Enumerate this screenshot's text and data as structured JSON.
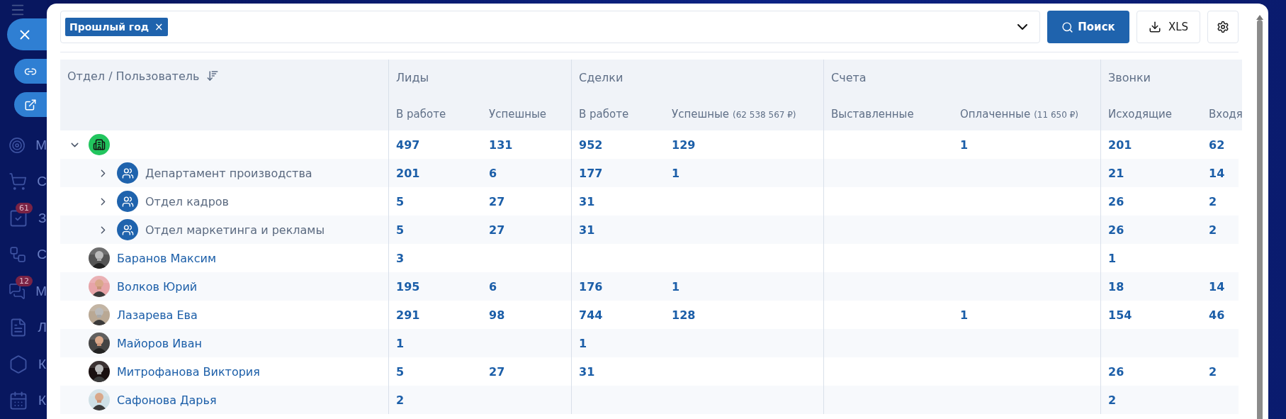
{
  "sidebar": {
    "items": [
      {
        "label": "М"
      },
      {
        "label": "С"
      },
      {
        "label": "З",
        "badge": "61"
      },
      {
        "label": "С"
      },
      {
        "label": "М",
        "badge": "12"
      },
      {
        "label": "Л"
      },
      {
        "label": "К"
      },
      {
        "label": "К"
      }
    ]
  },
  "filter": {
    "tags": [
      {
        "label": "Прошлый год",
        "remove": "×"
      }
    ]
  },
  "buttons": {
    "search": "Поиск",
    "export": "XLS"
  },
  "table": {
    "first_column": "Отдел / Пользователь",
    "groups": [
      {
        "title": "Лиды",
        "columns": [
          {
            "label": "В работе"
          },
          {
            "label": "Успешные"
          }
        ]
      },
      {
        "title": "Сделки",
        "columns": [
          {
            "label": "В работе"
          },
          {
            "label": "Успешные",
            "sum": "(62 538 567 ₽)"
          }
        ]
      },
      {
        "title": "Счета",
        "columns": [
          {
            "label": "Выставленные"
          },
          {
            "label": "Оплаченные",
            "sum": "(11 650 ₽)"
          }
        ]
      },
      {
        "title": "Звонки",
        "columns": [
          {
            "label": "Исходящие"
          },
          {
            "label": "Входя"
          }
        ]
      }
    ],
    "rows": [
      {
        "kind": "company",
        "expanded": true,
        "values": {
          "leads_in_work": "497",
          "leads_successful": "131",
          "deals_in_work": "952",
          "deals_successful": "129",
          "invoices_paid": "1",
          "calls_outgoing": "201",
          "column_9": "62"
        },
        "children": [
          {
            "kind": "department",
            "name": "Департамент производства",
            "expanded": false,
            "values": {
              "leads_in_work": "201",
              "leads_successful": "6",
              "deals_in_work": "177",
              "deals_successful": "1",
              "calls_outgoing": "21",
              "column_9": "14"
            }
          },
          {
            "kind": "department",
            "name": "Отдел кадров",
            "expanded": false,
            "values": {
              "leads_in_work": "5",
              "leads_successful": "27",
              "deals_in_work": "31",
              "calls_outgoing": "26",
              "column_9": "2"
            }
          },
          {
            "kind": "department",
            "name": "Отдел маркетинга и рекламы",
            "expanded": false,
            "values": {
              "leads_in_work": "5",
              "leads_successful": "27",
              "deals_in_work": "31",
              "calls_outgoing": "26",
              "column_9": "2"
            }
          },
          {
            "kind": "user",
            "name": "Баранов Максим",
            "values": {
              "leads_in_work": "3",
              "calls_outgoing": "1"
            }
          },
          {
            "kind": "user",
            "name": "Волков Юрий",
            "values": {
              "leads_in_work": "195",
              "leads_successful": "6",
              "deals_in_work": "176",
              "deals_successful": "1",
              "calls_outgoing": "18",
              "column_9": "14"
            }
          },
          {
            "kind": "user",
            "name": "Лазарева Ева",
            "values": {
              "leads_in_work": "291",
              "leads_successful": "98",
              "deals_in_work": "744",
              "deals_successful": "128",
              "invoices_paid": "1",
              "calls_outgoing": "154",
              "column_9": "46"
            }
          },
          {
            "kind": "user",
            "name": "Майоров Иван",
            "values": {
              "leads_in_work": "1",
              "deals_in_work": "1"
            }
          },
          {
            "kind": "user",
            "name": "Митрофанова Виктория",
            "values": {
              "leads_in_work": "5",
              "leads_successful": "27",
              "deals_in_work": "31",
              "calls_outgoing": "26",
              "column_9": "2"
            }
          },
          {
            "kind": "user",
            "name": "Сафонова Дарья",
            "values": {
              "leads_in_work": "2",
              "calls_outgoing": "2"
            }
          }
        ]
      }
    ]
  }
}
